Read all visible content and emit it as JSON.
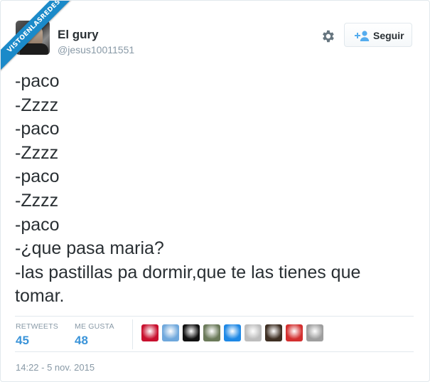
{
  "watermark": {
    "text": "VISTOENLASREDES"
  },
  "author": {
    "name": "El gury",
    "handle": "@jesus10011551"
  },
  "actions": {
    "settings_icon": "gear-icon",
    "follow_icon": "add-user-icon",
    "follow_label": "Seguir"
  },
  "tweet": {
    "lines": [
      "-paco",
      "-Zzzz",
      "-paco",
      "-Zzzz",
      "-paco",
      "-Zzzz",
      "-paco",
      "-¿que pasa maria?",
      "-las pastillas pa dormir,que te las tienes que",
      "tomar."
    ]
  },
  "stats": {
    "retweets_label": "RETWEETS",
    "retweets_value": "45",
    "likes_label": "ME GUSTA",
    "likes_value": "48"
  },
  "likers": [
    {
      "icon": "red-star-avatar",
      "color": "#c8102e"
    },
    {
      "icon": "cartoon-avatar",
      "color": "#6fa8dc"
    },
    {
      "icon": "black-logo-avatar",
      "color": "#111111"
    },
    {
      "icon": "landscape-avatar",
      "color": "#6b7a5a"
    },
    {
      "icon": "blue-glow-avatar",
      "color": "#1e88e5"
    },
    {
      "icon": "portrait-avatar",
      "color": "#bdbdbd"
    },
    {
      "icon": "dark-photo-avatar",
      "color": "#3e2f23"
    },
    {
      "icon": "anime-avatar",
      "color": "#d32f2f"
    },
    {
      "icon": "robot-avatar",
      "color": "#9e9e9e"
    }
  ],
  "timestamp": "14:22 - 5 nov. 2015",
  "colors": {
    "accent": "#3b94d9",
    "muted": "#8899a6",
    "border": "#e1e8ed",
    "ribbon": "#1b8ac9"
  }
}
